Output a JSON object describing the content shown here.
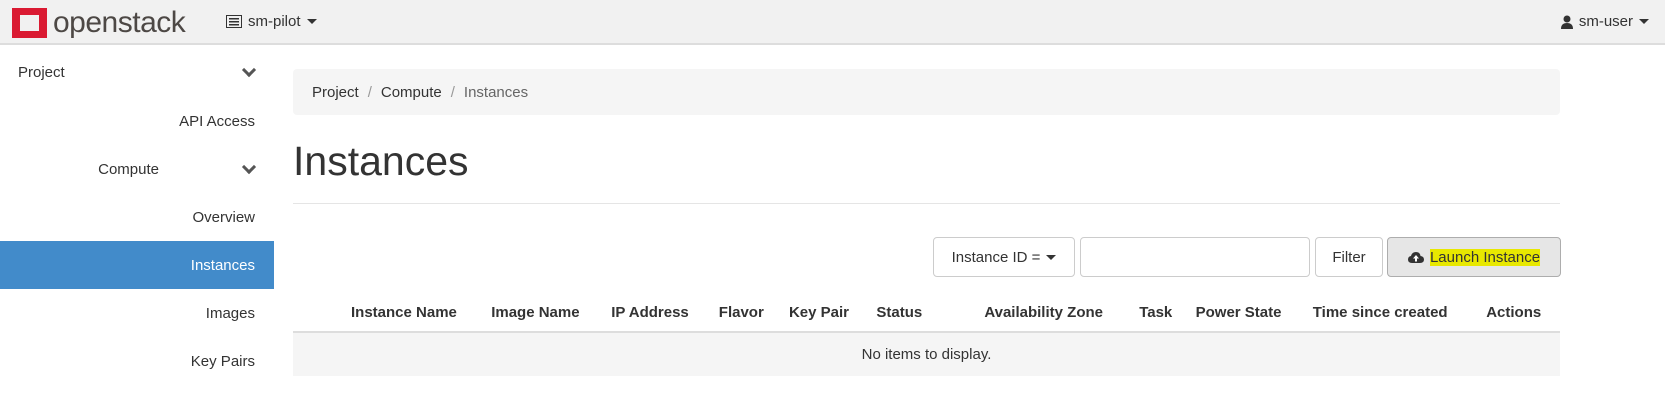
{
  "header": {
    "logo_text": "openstack",
    "project": "sm-pilot",
    "user": "sm-user"
  },
  "sidebar": {
    "items": [
      {
        "label": "Project"
      },
      {
        "label": "API Access"
      },
      {
        "label": "Compute"
      },
      {
        "label": "Overview"
      },
      {
        "label": "Instances"
      },
      {
        "label": "Images"
      },
      {
        "label": "Key Pairs"
      }
    ]
  },
  "breadcrumb": [
    "Project",
    "Compute",
    "Instances"
  ],
  "page_title": "Instances",
  "filter": {
    "field": "Instance ID =",
    "value": "",
    "button": "Filter"
  },
  "launch_label": "Launch Instance",
  "table": {
    "columns": [
      "Instance Name",
      "Image Name",
      "IP Address",
      "Flavor",
      "Key Pair",
      "Status",
      "Availability Zone",
      "Task",
      "Power State",
      "Time since created",
      "Actions"
    ],
    "empty": "No items to display."
  },
  "colors": {
    "active": "#428bca",
    "logo": "#da1a32",
    "highlight": "#e8e800"
  }
}
